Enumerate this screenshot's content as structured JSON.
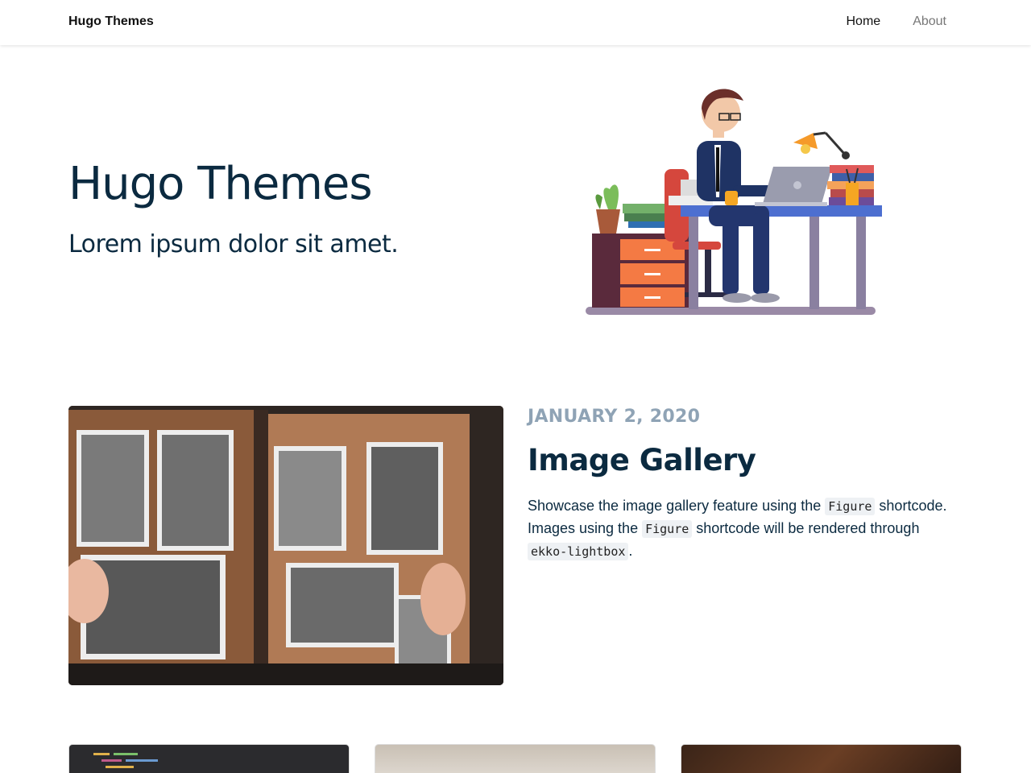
{
  "navbar": {
    "brand": "Hugo Themes",
    "links": [
      "Home",
      "About"
    ]
  },
  "hero": {
    "title": "Hugo Themes",
    "subtitle": "Lorem ipsum dolor sit amet."
  },
  "featured_post": {
    "date": "JANUARY 2, 2020",
    "title": "Image Gallery",
    "summary_1": "Showcase the image gallery feature using the ",
    "code_1": "Figure",
    "summary_2": " shortcode. Images using the ",
    "code_2": "Figure",
    "summary_3": " shortcode will be rendered through ",
    "code_3": "ekko-lightbox",
    "summary_4": "."
  },
  "colors": {
    "heading": "#0b2a40",
    "date": "#8fa3b5",
    "code_bg": "#eef1f4"
  }
}
